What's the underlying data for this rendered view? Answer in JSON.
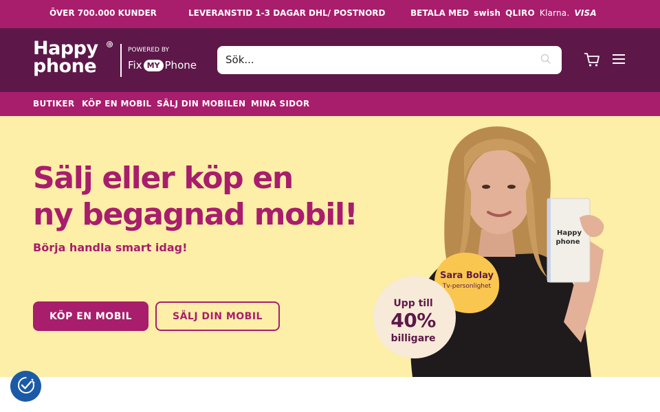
{
  "topbar": {
    "customers": "ÖVER 700.000 KUNDER",
    "delivery": "LEVERANSTID 1-3 DAGAR DHL/ POSTNORD",
    "pay_label": "BETALA MED",
    "payment_methods": [
      "swish",
      "QLIRO",
      "Klarna.",
      "VISA"
    ]
  },
  "header": {
    "logo_line1": "Happy",
    "logo_line2": "phone",
    "powered_by": "POWERED BY",
    "partner_fix": "Fix",
    "partner_my": "MY",
    "partner_phone": "Phone",
    "search_placeholder": "Sök...",
    "icons": {
      "search": "search-icon",
      "cart": "cart-icon",
      "menu": "menu-icon"
    }
  },
  "nav": {
    "items": [
      "BUTIKER",
      "KÖP EN MOBIL",
      "SÄLJ DIN MOBILEN",
      "MINA SIDOR"
    ]
  },
  "hero": {
    "headline_line1": "Sälj eller köp en",
    "headline_line2": "ny begagnad mobil!",
    "subheadline": "Börja handla smart idag!",
    "primary_button": "KÖP EN MOBIL",
    "secondary_button": "SÄLJ DIN MOBIL",
    "badge_name": "Sara Bolay",
    "badge_role": "Tv-personlighet",
    "offer_line1": "Upp till",
    "offer_line2": "40%",
    "offer_line3": "billigare",
    "box_text_line1": "Happy",
    "box_text_line2": "phone"
  },
  "colors": {
    "brand_magenta": "#a81d6c",
    "brand_dark": "#5d1849",
    "hero_bg": "#fdeea8",
    "badge_yellow": "#f9c74f",
    "badge_cream": "#f7ead8",
    "cookie_blue": "#1b5aa6"
  }
}
